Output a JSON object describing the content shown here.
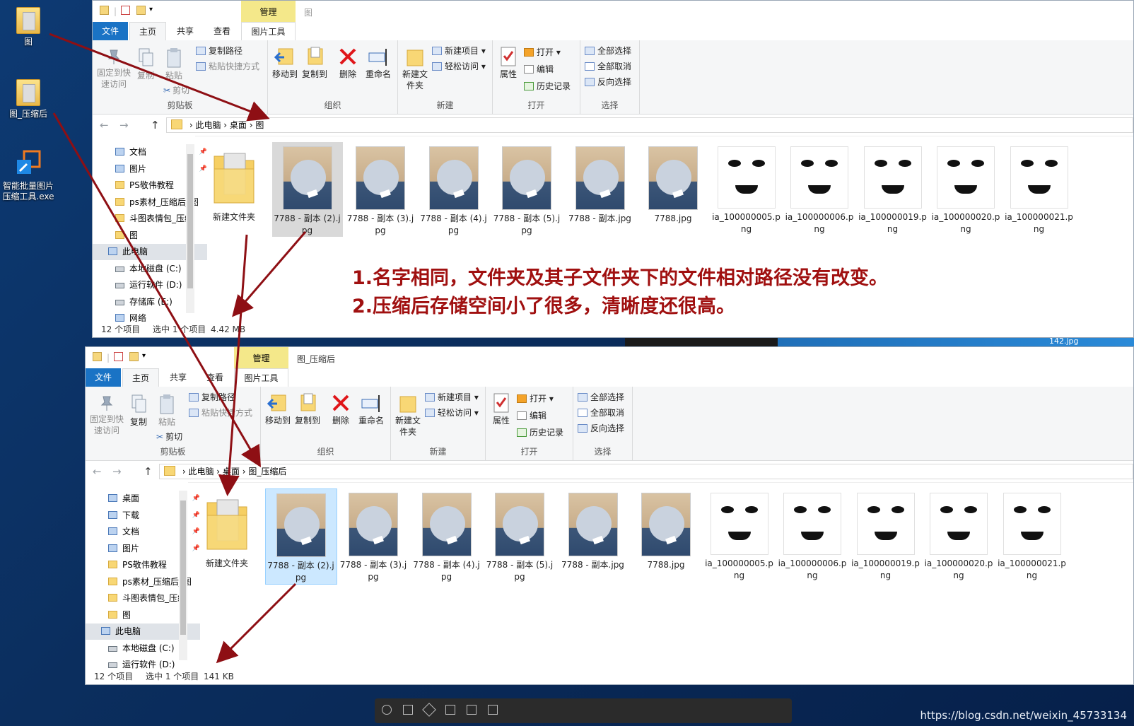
{
  "desktop": {
    "icons": [
      {
        "label": "图"
      },
      {
        "label": "图_压缩后"
      },
      {
        "label": "智能批量图片压缩工具.exe"
      }
    ]
  },
  "window_top": {
    "manage_tab": "管理",
    "title": "图",
    "tabs": {
      "file": "文件",
      "home": "主页",
      "share": "共享",
      "view": "查看",
      "picture_tools": "图片工具"
    },
    "ribbon": {
      "clipboard": {
        "pin": "固定到快速访问",
        "copy": "复制",
        "paste": "粘贴",
        "copy_path": "复制路径",
        "paste_shortcut": "粘贴快捷方式",
        "cut": "剪切",
        "label": "剪贴板"
      },
      "organize": {
        "move_to": "移动到",
        "copy_to": "复制到",
        "delete": "删除",
        "rename": "重命名",
        "label": "组织"
      },
      "new": {
        "new_folder": "新建文件夹",
        "new_item": "新建项目",
        "easy_access": "轻松访问",
        "label": "新建"
      },
      "open": {
        "properties": "属性",
        "open": "打开",
        "edit": "编辑",
        "history": "历史记录",
        "label": "打开"
      },
      "select": {
        "select_all": "全部选择",
        "select_none": "全部取消",
        "invert": "反向选择",
        "label": "选择"
      }
    },
    "breadcrumb": [
      "此电脑",
      "桌面",
      "图"
    ],
    "nav": [
      {
        "label": "文档",
        "pin": true,
        "kind": "doc"
      },
      {
        "label": "图片",
        "pin": true,
        "kind": "pic"
      },
      {
        "label": "PS敬伟教程",
        "pin": false,
        "kind": "folder"
      },
      {
        "label": "ps素材_压缩后_图",
        "pin": false,
        "kind": "folder"
      },
      {
        "label": "斗图表情包_压缩",
        "pin": false,
        "kind": "folder"
      },
      {
        "label": "图",
        "pin": false,
        "kind": "folder"
      },
      {
        "label": "此电脑",
        "pin": false,
        "kind": "pc"
      },
      {
        "label": "本地磁盘 (C:)",
        "pin": false,
        "kind": "drive"
      },
      {
        "label": "运行软件 (D:)",
        "pin": false,
        "kind": "drive"
      },
      {
        "label": "存储库 (E:)",
        "pin": false,
        "kind": "drive"
      },
      {
        "label": "网络",
        "pin": false,
        "kind": "net"
      }
    ],
    "files": [
      {
        "name": "新建文件夹",
        "kind": "folder"
      },
      {
        "name": "7788 - 副本 (2).jpg",
        "kind": "photo"
      },
      {
        "name": "7788 - 副本 (3).jpg",
        "kind": "photo"
      },
      {
        "name": "7788 - 副本 (4).jpg",
        "kind": "photo"
      },
      {
        "name": "7788 - 副本 (5).jpg",
        "kind": "photo"
      },
      {
        "name": "7788 - 副本.jpg",
        "kind": "photo"
      },
      {
        "name": "7788.jpg",
        "kind": "photo"
      },
      {
        "name": "ia_100000005.png",
        "kind": "face"
      },
      {
        "name": "ia_100000006.png",
        "kind": "face"
      },
      {
        "name": "ia_100000019.png",
        "kind": "face"
      },
      {
        "name": "ia_100000020.png",
        "kind": "face"
      },
      {
        "name": "ia_100000021.png",
        "kind": "face"
      }
    ],
    "status": {
      "count": "12 个项目",
      "selected": "选中 1 个项目",
      "size": "4.42 MB"
    }
  },
  "window_bottom": {
    "manage_tab": "管理",
    "title": "图_压缩后",
    "tabs": {
      "file": "文件",
      "home": "主页",
      "share": "共享",
      "view": "查看",
      "picture_tools": "图片工具"
    },
    "ribbon": {
      "clipboard": {
        "pin": "固定到快速访问",
        "copy": "复制",
        "paste": "粘贴",
        "copy_path": "复制路径",
        "paste_shortcut": "粘贴快捷方式",
        "cut": "剪切",
        "label": "剪贴板"
      },
      "organize": {
        "move_to": "移动到",
        "copy_to": "复制到",
        "delete": "删除",
        "rename": "重命名",
        "label": "组织"
      },
      "new": {
        "new_folder": "新建文件夹",
        "new_item": "新建项目",
        "easy_access": "轻松访问",
        "label": "新建"
      },
      "open": {
        "properties": "属性",
        "open": "打开",
        "edit": "编辑",
        "history": "历史记录",
        "label": "打开"
      },
      "select": {
        "select_all": "全部选择",
        "select_none": "全部取消",
        "invert": "反向选择",
        "label": "选择"
      }
    },
    "breadcrumb": [
      "此电脑",
      "桌面",
      "图_压缩后"
    ],
    "nav": [
      {
        "label": "桌面",
        "pin": true,
        "kind": "pc"
      },
      {
        "label": "下载",
        "pin": true,
        "kind": "dl"
      },
      {
        "label": "文档",
        "pin": true,
        "kind": "doc"
      },
      {
        "label": "图片",
        "pin": true,
        "kind": "pic"
      },
      {
        "label": "PS敬伟教程",
        "pin": false,
        "kind": "folder"
      },
      {
        "label": "ps素材_压缩后_图",
        "pin": false,
        "kind": "folder"
      },
      {
        "label": "斗图表情包_压缩",
        "pin": false,
        "kind": "folder"
      },
      {
        "label": "图",
        "pin": false,
        "kind": "folder"
      },
      {
        "label": "此电脑",
        "pin": false,
        "kind": "pc"
      },
      {
        "label": "本地磁盘 (C:)",
        "pin": false,
        "kind": "drive"
      },
      {
        "label": "运行软件 (D:)",
        "pin": false,
        "kind": "drive"
      }
    ],
    "files": [
      {
        "name": "新建文件夹",
        "kind": "folder"
      },
      {
        "name": "7788 - 副本 (2).jpg",
        "kind": "photo"
      },
      {
        "name": "7788 - 副本 (3).jpg",
        "kind": "photo"
      },
      {
        "name": "7788 - 副本 (4).jpg",
        "kind": "photo"
      },
      {
        "name": "7788 - 副本 (5).jpg",
        "kind": "photo"
      },
      {
        "name": "7788 - 副本.jpg",
        "kind": "photo"
      },
      {
        "name": "7788.jpg",
        "kind": "photo"
      },
      {
        "name": "ia_100000005.png",
        "kind": "face"
      },
      {
        "name": "ia_100000006.png",
        "kind": "face"
      },
      {
        "name": "ia_100000019.png",
        "kind": "face"
      },
      {
        "name": "ia_100000020.png",
        "kind": "face"
      },
      {
        "name": "ia_100000021.png",
        "kind": "face"
      }
    ],
    "status": {
      "count": "12 个项目",
      "selected": "选中 1 个项目",
      "size": "141 KB"
    }
  },
  "annotation": {
    "line1": "1.名字相同，文件夹及其子文件夹下的文件相对路径没有改变。",
    "line2": "2.压缩后存储空间小了很多，清晰度还很高。"
  },
  "background_file_label": "142.jpg",
  "watermark": "https://blog.csdn.net/weixin_45733134",
  "colors": {
    "accent": "#1a73c5",
    "annotation": "#a01010",
    "manage_tab": "#f4e88a",
    "selection": "#cce8ff"
  }
}
